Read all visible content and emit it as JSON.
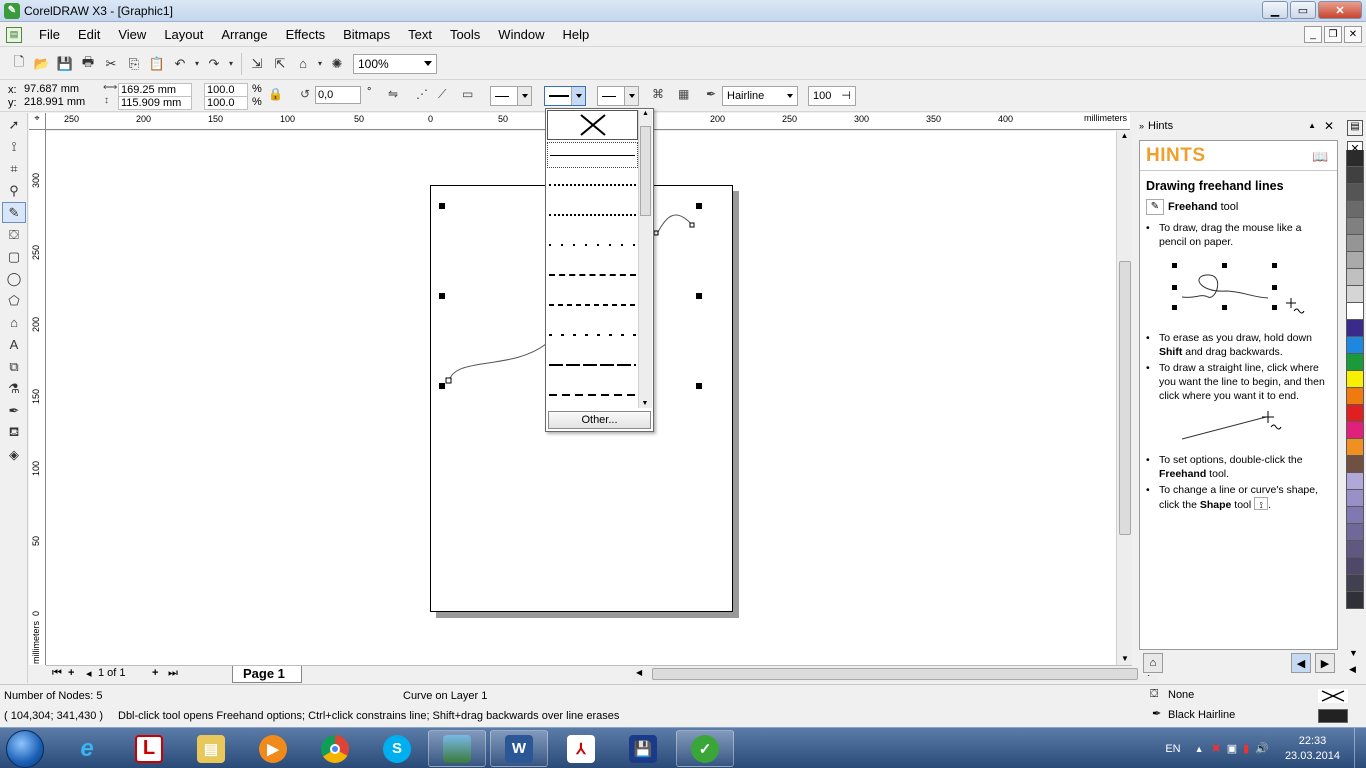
{
  "window": {
    "title": "CorelDRAW X3 - [Graphic1]",
    "controls": [
      "minimize",
      "maximize",
      "close"
    ]
  },
  "menu": {
    "items": [
      "File",
      "Edit",
      "View",
      "Layout",
      "Arrange",
      "Effects",
      "Bitmaps",
      "Text",
      "Tools",
      "Window",
      "Help"
    ]
  },
  "standard_toolbar": {
    "zoom_value": "100%"
  },
  "property_bar": {
    "x": "97.687 mm",
    "y": "218.991 mm",
    "width": "169.25 mm",
    "height": "115.909 mm",
    "scale_x": "100.0",
    "scale_y": "100.0",
    "percent_symbol": "%",
    "rotation": "0,0",
    "degree_symbol": "°",
    "outline_width": "Hairline",
    "smoothing": "100",
    "x_label": "x:",
    "y_label": "y:"
  },
  "rulers": {
    "unit": "millimeters",
    "top_labels": [
      "250",
      "200",
      "150",
      "100",
      "50",
      "0",
      "50",
      "200",
      "250",
      "300",
      "350",
      "400"
    ],
    "left_labels": [
      "300",
      "250",
      "200",
      "150",
      "100",
      "50",
      "0"
    ]
  },
  "line_style_dropdown": {
    "other_button": "Other..."
  },
  "page_nav": {
    "page_count": "1 of 1",
    "page_tab": "Page 1"
  },
  "hints": {
    "docker_title": "Hints",
    "heading": "HINTS",
    "topic_title": "Drawing freehand lines",
    "tool_name": "Freehand",
    "tool_suffix": " tool",
    "bullet1": "To draw, drag the mouse like a pencil on paper.",
    "bullet2_a": "To erase as you draw, hold down ",
    "bullet2_b": "Shift",
    "bullet2_c": " and drag backwards.",
    "bullet3": "To draw a straight line, click where you want the line to begin, and then click where you want it to end.",
    "bullet4_a": "To set options, double-click the ",
    "bullet4_b": "Freehand",
    "bullet4_c": " tool.",
    "bullet5_a": "To change a line or curve's shape, click the ",
    "bullet5_b": "Shape",
    "bullet5_c": " tool"
  },
  "status": {
    "nodes": "Number of Nodes: 5",
    "object": "Curve on Layer 1",
    "coords": "( 104,304; 341,430 )",
    "hint_text": "Dbl-click tool opens Freehand options; Ctrl+click constrains line; Shift+drag backwards over line erases",
    "fill_label": "None",
    "outline_label": "Black  Hairline"
  },
  "taskbar": {
    "language": "EN",
    "time": "22:33",
    "date": "23.03.2014"
  },
  "palette_colors": [
    "#2b2b2b",
    "#404040",
    "#555555",
    "#6a6a6a",
    "#808080",
    "#959595",
    "#aaaaaa",
    "#c0c0c0",
    "#d5d5d5",
    "#ffffff",
    "#3a2a8a",
    "#1e88e0",
    "#1a9a3a",
    "#f8f000",
    "#f07a10",
    "#e02020",
    "#e0207a",
    "#f09020",
    "#705040",
    "#b0a8d8",
    "#9a90c8",
    "#8078b0",
    "#706898",
    "#605880",
    "#504868",
    "#404050",
    "#303038"
  ]
}
